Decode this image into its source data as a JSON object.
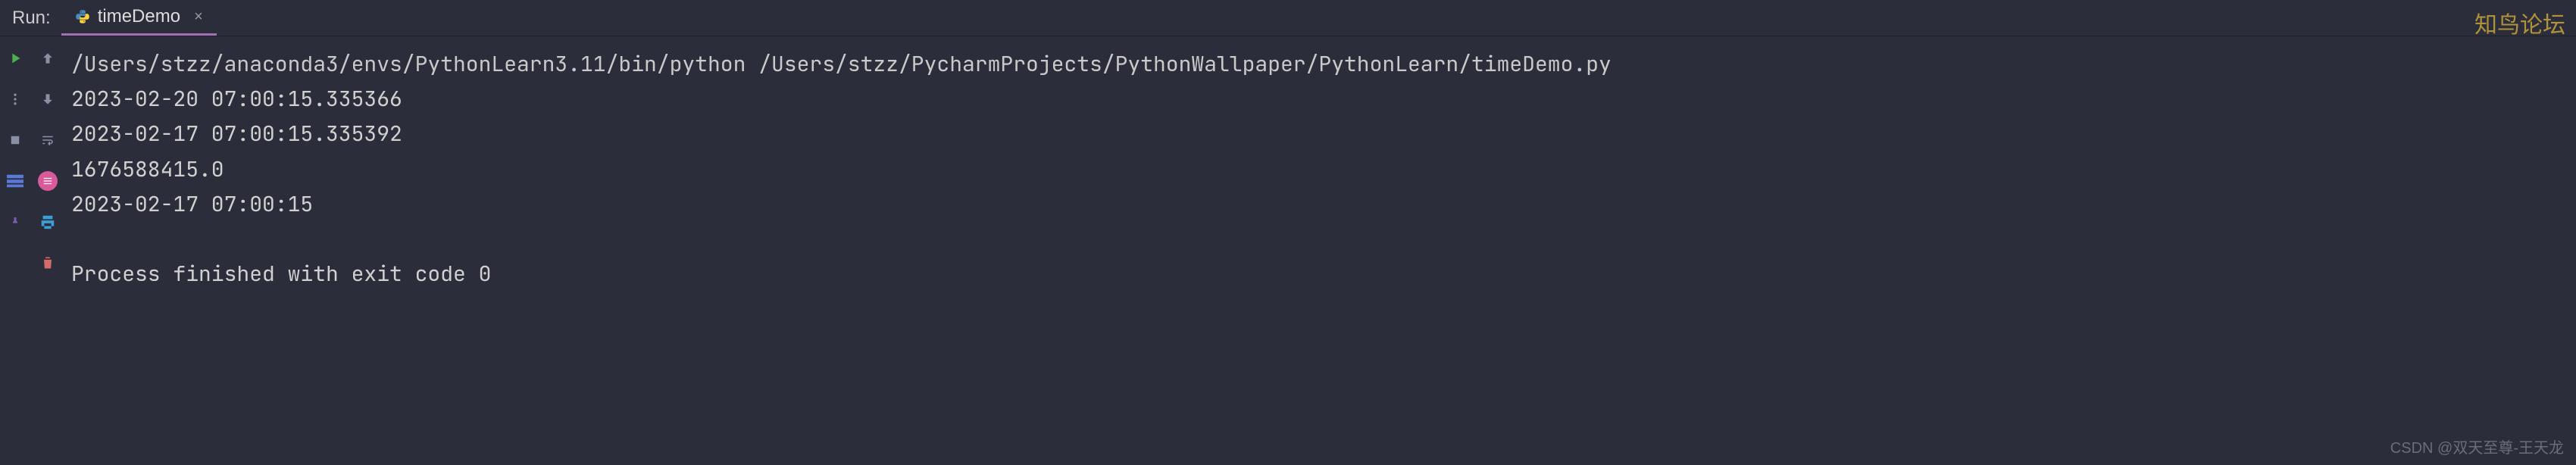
{
  "header": {
    "run_label": "Run:",
    "tab": {
      "icon": "python-file-icon",
      "label": "timeDemo",
      "close": "×"
    }
  },
  "gutter_left": [
    {
      "name": "run-button",
      "icon": "play-icon",
      "interactable": true
    },
    {
      "name": "more-button",
      "icon": "dots-icon",
      "interactable": true
    },
    {
      "name": "stop-button",
      "icon": "stop-icon",
      "interactable": true
    },
    {
      "name": "layout-button",
      "icon": "badge-rows",
      "interactable": true
    },
    {
      "name": "pin-button",
      "icon": "pin-icon",
      "interactable": true
    }
  ],
  "gutter_right": [
    {
      "name": "scroll-up-button",
      "icon": "arrow-up-icon",
      "interactable": true
    },
    {
      "name": "scroll-down-button",
      "icon": "arrow-down-icon",
      "interactable": true
    },
    {
      "name": "soft-wrap-button",
      "icon": "wrap-icon",
      "interactable": true
    },
    {
      "name": "trace-button",
      "icon": "badge-pink",
      "interactable": true
    },
    {
      "name": "print-button",
      "icon": "printer-icon",
      "interactable": true
    },
    {
      "name": "clear-button",
      "icon": "trash-icon",
      "interactable": true
    }
  ],
  "console": {
    "command": "/Users/stzz/anaconda3/envs/PythonLearn3.11/bin/python /Users/stzz/PycharmProjects/PythonWallpaper/PythonLearn/timeDemo.py",
    "lines": [
      "2023-02-20 07:00:15.335366",
      "2023-02-17 07:00:15.335392",
      "1676588415.0",
      "2023-02-17 07:00:15",
      "",
      "Process finished with exit code 0"
    ]
  },
  "watermarks": {
    "top_right": "知鸟论坛",
    "bottom_right": "CSDN @双天至尊-王天龙"
  }
}
